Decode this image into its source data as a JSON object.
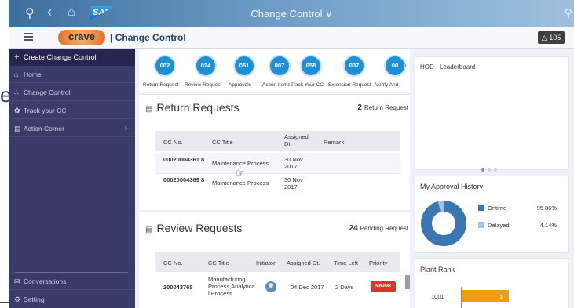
{
  "shell": {
    "title": "Change Control ∨",
    "icons": [
      "user-icon",
      "back-icon",
      "home-icon",
      "search-icon"
    ],
    "sap_logo_text": "SAP"
  },
  "left_glyph": "e",
  "header": {
    "logo_text": "crave",
    "logo_tagline": "· · ·",
    "title": "| Change Control",
    "notifications_label": "△ 105"
  },
  "sidebar": {
    "create_label": "Create Change Control",
    "items": [
      {
        "label": "Home",
        "icon": "home-icon"
      },
      {
        "label": "Change Control",
        "icon": "network-icon"
      },
      {
        "label": "Track your CC",
        "icon": "gear-icon"
      },
      {
        "label": "Action Corner",
        "icon": "document-icon",
        "has_chevron": true
      }
    ],
    "bottom_items": [
      {
        "label": "Conversations",
        "icon": "chat-icon"
      },
      {
        "label": "Setting",
        "icon": "settings-icon"
      }
    ]
  },
  "tiles": [
    {
      "count": "002",
      "label": "Return Request"
    },
    {
      "count": "024",
      "label": "Review Request"
    },
    {
      "count": "051",
      "label": "Approvals"
    },
    {
      "count": "007",
      "label": "Action Items"
    },
    {
      "count": "058",
      "label": "Track Your CC"
    },
    {
      "count": "007",
      "label": "Extension Request"
    },
    {
      "count": "00",
      "label": "Verify And"
    }
  ],
  "return_requests": {
    "title": "Return Requests",
    "count": "2",
    "count_label": "Return Request",
    "columns": [
      "CC No.",
      "CC Title",
      "Assigned Dt.",
      "Remark"
    ],
    "rows": [
      {
        "cc_no": "00020004361 8",
        "title": "Maintenance Process",
        "assigned": "30 Nov 2017",
        "remark": ""
      },
      {
        "cc_no": "00020004369 8",
        "title": "Maintenance Process",
        "assigned": "30 Nov 2017",
        "remark": ""
      }
    ]
  },
  "review_requests": {
    "title": "Review Requests",
    "count": "24",
    "count_label": "Pending Request",
    "columns": [
      "CC No.",
      "CC Title",
      "Initiator",
      "Assigned Dt.",
      "Time Left",
      "Priority"
    ],
    "rows": [
      {
        "cc_no": "200043765",
        "title": "Manufacturing Process,Analytica l Process",
        "assigned": "04 Dec 2017",
        "time_left": "2 Days",
        "priority": "MAJOR"
      }
    ]
  },
  "leaderboard": {
    "title": "HOD - Leaderboard"
  },
  "approval_history": {
    "title": "My Approval History",
    "series": [
      {
        "name": "Ontime",
        "value": 95.86,
        "label": "95.86%",
        "color": "#3a77b2"
      },
      {
        "name": "Delayed",
        "value": 4.14,
        "label": "4.14%",
        "color": "#9fc3e3"
      }
    ]
  },
  "plant_rank": {
    "title": "Plant Rank",
    "rows": [
      {
        "plant": "1001",
        "value": 1
      }
    ],
    "bar_color": "#f39c12"
  },
  "colors": {
    "sidebar_bg": "#3b3b6a",
    "sidebar_active": "#262650",
    "tile_blue": "#1f8fd6",
    "priority_major": "#e0322d",
    "brand_title": "#1d3f7a"
  }
}
